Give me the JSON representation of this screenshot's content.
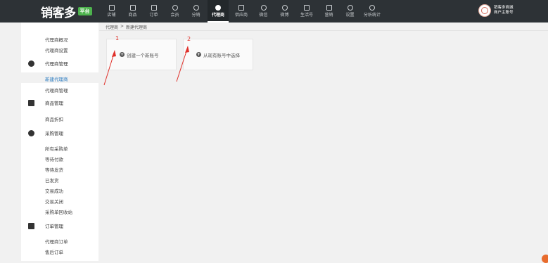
{
  "brand": {
    "name": "销客多",
    "badge": "平台"
  },
  "nav": [
    {
      "label": "店铺",
      "icon": "store-icon"
    },
    {
      "label": "商品",
      "icon": "basket-icon"
    },
    {
      "label": "订单",
      "icon": "order-icon"
    },
    {
      "label": "会员",
      "icon": "member-icon"
    },
    {
      "label": "分销",
      "icon": "distribution-icon"
    },
    {
      "label": "代理商",
      "icon": "agent-icon",
      "active": true
    },
    {
      "label": "供应商",
      "icon": "supplier-icon"
    },
    {
      "label": "微信",
      "icon": "wechat-icon"
    },
    {
      "label": "微博",
      "icon": "weibo-icon"
    },
    {
      "label": "生活号",
      "icon": "life-icon"
    },
    {
      "label": "营销",
      "icon": "marketing-icon"
    },
    {
      "label": "设置",
      "icon": "settings-icon"
    },
    {
      "label": "分析统计",
      "icon": "analytics-icon"
    }
  ],
  "user": {
    "line1": "销客多商城",
    "line2": "商户主账号"
  },
  "sidebar": {
    "top_items": [
      "代理商概况",
      "代理商设置"
    ],
    "agent_mgmt": {
      "title": "代理商管理",
      "active": "新建代理商",
      "items": [
        "代理商管理"
      ]
    },
    "goods_mgmt": {
      "title": "商品管理",
      "items": [
        "商品折扣"
      ]
    },
    "purchase_mgmt": {
      "title": "采购管理",
      "items": [
        "所有采购单",
        "等待付款",
        "等待发货",
        "已发货",
        "交易成功",
        "交易关闭",
        "采购单回收站"
      ]
    },
    "order_mgmt": {
      "title": "订单管理",
      "items": [
        "代理商订单",
        "售后订单"
      ]
    }
  },
  "breadcrumb": {
    "parent": "代理商",
    "separator": ">",
    "current": "新建代理商"
  },
  "cards": [
    {
      "label": "创建一个新账号",
      "annotation": "1"
    },
    {
      "label": "从现有账号中选择",
      "annotation": "2"
    }
  ],
  "colors": {
    "topbar": "#2d3236",
    "accent_link": "#2a7bc1",
    "annotation": "#e0302a"
  }
}
